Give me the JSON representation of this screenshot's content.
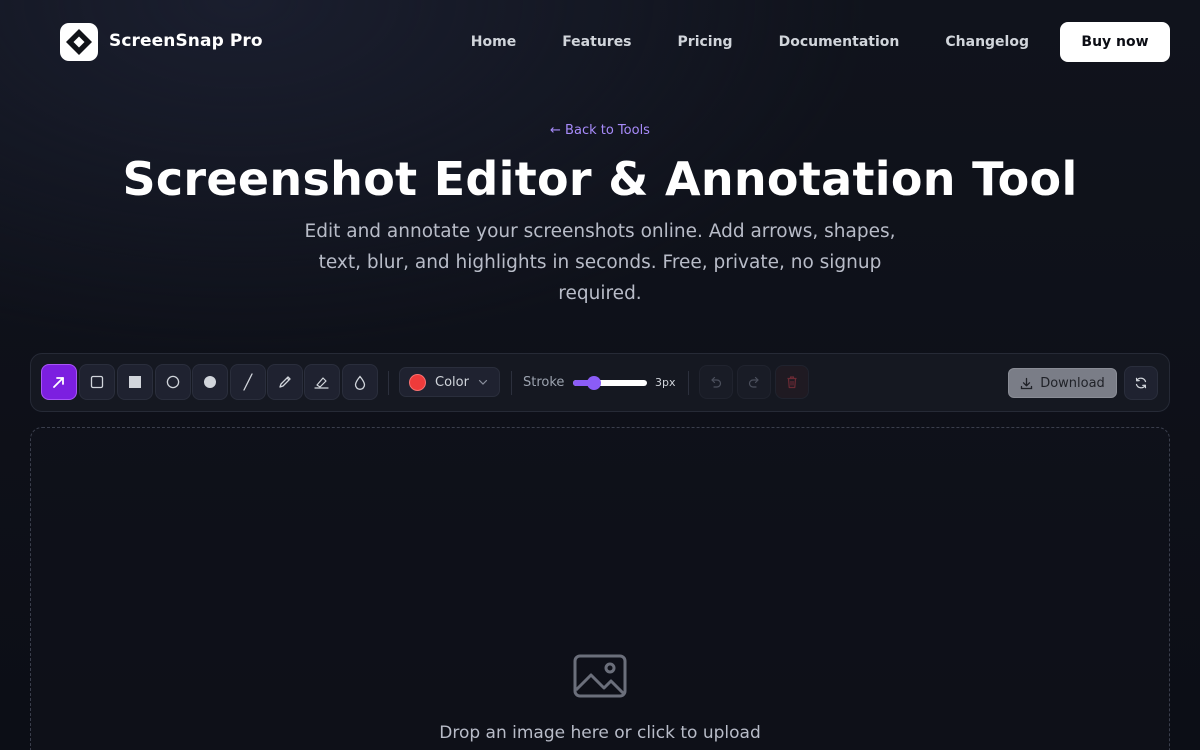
{
  "nav": {
    "brand": "ScreenSnap Pro",
    "links": [
      "Home",
      "Features",
      "Pricing",
      "Documentation",
      "Changelog"
    ],
    "buy_label": "Buy now"
  },
  "hero": {
    "back_link": "← Back to Tools",
    "title": "Screenshot Editor & Annotation Tool",
    "subtitle": "Edit and annotate your screenshots online. Add arrows, shapes, text, blur, and highlights in seconds. Free, private, no signup required."
  },
  "toolbar": {
    "tools": [
      {
        "name": "arrow-tool",
        "icon": "arrow-icon",
        "active": true
      },
      {
        "name": "rectangle-tool",
        "icon": "rectangle-outline-icon",
        "active": false
      },
      {
        "name": "filled-rectangle-tool",
        "icon": "rectangle-filled-icon",
        "active": false
      },
      {
        "name": "circle-tool",
        "icon": "circle-outline-icon",
        "active": false
      },
      {
        "name": "filled-circle-tool",
        "icon": "circle-filled-icon",
        "active": false
      },
      {
        "name": "line-tool",
        "icon": "line-icon",
        "active": false
      },
      {
        "name": "pen-tool",
        "icon": "pencil-icon",
        "active": false
      },
      {
        "name": "highlighter-tool",
        "icon": "highlighter-icon",
        "active": false
      },
      {
        "name": "blur-tool",
        "icon": "droplet-icon",
        "active": false
      }
    ],
    "color_label": "Color",
    "selected_color": "#ef3b3b",
    "stroke_label": "Stroke",
    "stroke_value": "3px",
    "stroke_level": 0.28,
    "download_label": "Download",
    "accent_color": "#7c1fe0"
  },
  "dropzone": {
    "text": "Drop an image here or click to upload",
    "icon": "image-icon"
  }
}
